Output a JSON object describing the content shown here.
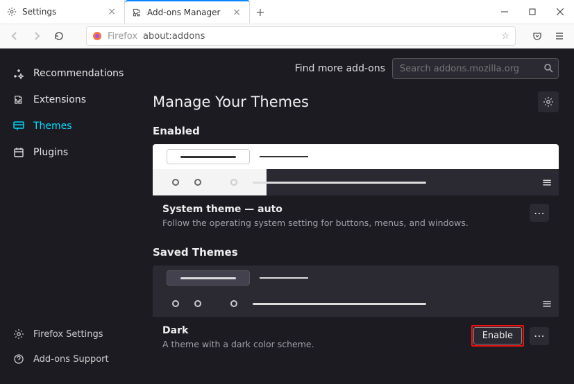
{
  "tabs": [
    {
      "label": "Settings"
    },
    {
      "label": "Add-ons Manager"
    }
  ],
  "url": {
    "identity": "Firefox",
    "address": "about:addons"
  },
  "topstrip": {
    "find_label": "Find more add-ons",
    "search_placeholder": "Search addons.mozilla.org"
  },
  "sidebar": {
    "items": [
      {
        "label": "Recommendations"
      },
      {
        "label": "Extensions"
      },
      {
        "label": "Themes"
      },
      {
        "label": "Plugins"
      }
    ],
    "footer": [
      {
        "label": "Firefox Settings"
      },
      {
        "label": "Add-ons Support"
      }
    ]
  },
  "page": {
    "title": "Manage Your Themes"
  },
  "sections": {
    "enabled_title": "Enabled",
    "saved_title": "Saved Themes"
  },
  "themes": {
    "system": {
      "name": "System theme — auto",
      "desc": "Follow the operating system setting for buttons, menus, and windows."
    },
    "dark": {
      "name": "Dark",
      "desc": "A theme with a dark color scheme.",
      "enable_label": "Enable"
    }
  }
}
